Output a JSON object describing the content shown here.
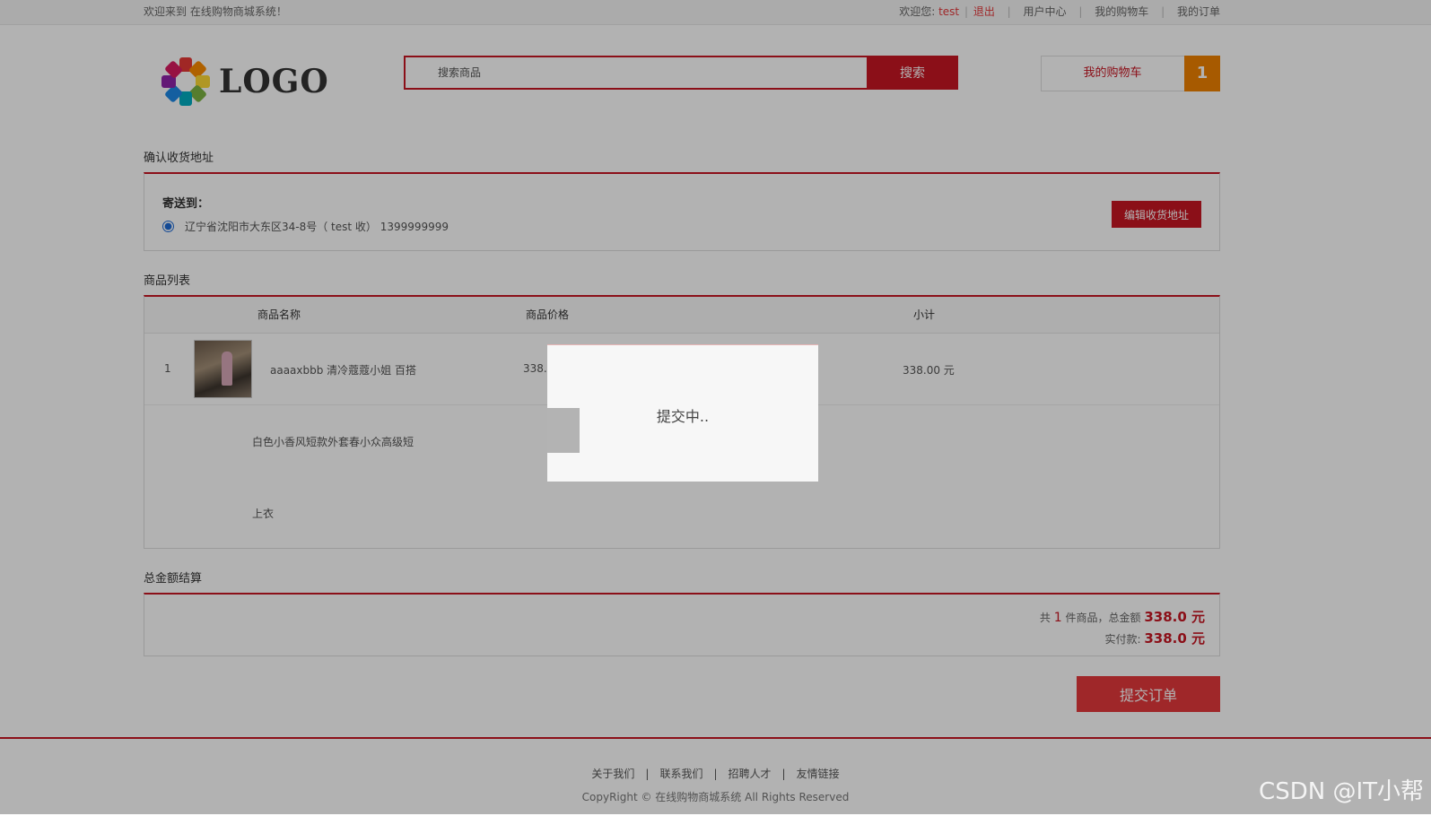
{
  "topbar": {
    "welcome": "欢迎来到 在线购物商城系统！",
    "greeting": "欢迎您:",
    "username": "test",
    "logout": "退出",
    "user_center": "用户中心",
    "my_cart": "我的购物车",
    "my_orders": "我的订单"
  },
  "header": {
    "logo_text": "LOGO",
    "search_placeholder": "搜索商品",
    "search_button": "搜索",
    "cart_label": "我的购物车",
    "cart_count": "1"
  },
  "address": {
    "section_title": "确认收货地址",
    "ship_to": "寄送到：",
    "line": "辽宁省沈阳市大东区34-8号（ test 收） 1399999999",
    "edit_button": "编辑收货地址"
  },
  "goods": {
    "section_title": "商品列表",
    "columns": [
      "商品名称",
      "商品价格",
      "小计"
    ],
    "item": {
      "index": "1",
      "name_line1": "aaaaxbbb 清冷蔻蔻小姐 百搭",
      "name_line2": "白色小香风短款外套春小众高级短",
      "name_line3": "上衣",
      "price": "338.0",
      "subtotal": "338.00 元"
    }
  },
  "totals": {
    "section_title": "总金额结算",
    "prefix": "共",
    "count": "1",
    "middle": "件商品，总金额",
    "total": "338.0 元",
    "paid_label": "实付款:",
    "paid": "338.0 元"
  },
  "submit_label": "提交订单",
  "footer": {
    "links": [
      "关于我们",
      "联系我们",
      "招聘人才",
      "友情链接"
    ],
    "copyright": "CopyRight © 在线购物商城系统 All Rights Reserved"
  },
  "watermark": "CSDN @IT小帮",
  "dialog": {
    "message": "提交中.."
  },
  "colors": {
    "brand": "#c81623",
    "accent": "#f08200",
    "overlay": "rgba(0,0,0,0.30)"
  }
}
